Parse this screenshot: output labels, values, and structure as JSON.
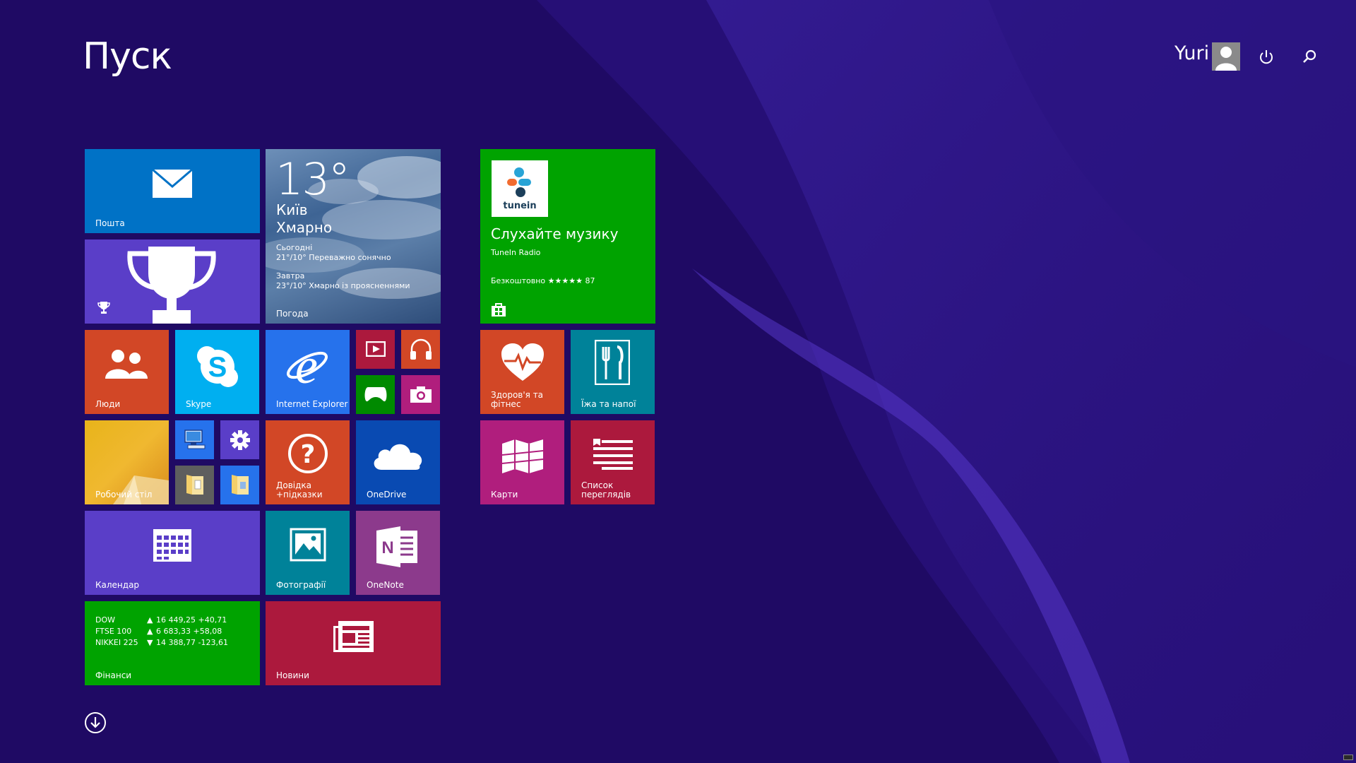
{
  "screen": {
    "title": "Пуск",
    "user": "Yuri",
    "background": "#1f0a64"
  },
  "tiles": {
    "mail": {
      "label": "Пошта",
      "color": "#0072c6",
      "icon": "mail-icon"
    },
    "games": {
      "label": "",
      "color": "#5a3ec8",
      "icon": "trophy-icon"
    },
    "weather": {
      "label": "Погода",
      "temp": "13°",
      "city": "Київ",
      "condition": "Хмарно",
      "today_label": "Сьогодні",
      "today_forecast": "21°/10° Переважно сонячно",
      "tomorrow_label": "Завтра",
      "tomorrow_forecast": "23°/10° Хмарно із проясненнями"
    },
    "people": {
      "label": "Люди",
      "color": "#d24726",
      "icon": "people-icon"
    },
    "skype": {
      "label": "Skype",
      "color": "#00aff0",
      "icon": "skype-icon"
    },
    "ie": {
      "label": "Internet Explorer",
      "color": "#2672ec",
      "icon": "internet-explorer-icon"
    },
    "video": {
      "color": "#ac193d",
      "icon": "video-icon"
    },
    "music": {
      "color": "#d24726",
      "icon": "headphones-icon"
    },
    "xbox": {
      "color": "#008a00",
      "icon": "gamepad-icon"
    },
    "camera": {
      "color": "#b01e7d",
      "icon": "camera-icon"
    },
    "desktop": {
      "label": "Робочий стіл",
      "color": "#e3a21a",
      "icon": "desktop-wallpaper"
    },
    "computer": {
      "color": "#2672ec",
      "icon": "computer-icon"
    },
    "settings": {
      "color": "#5a3ec8",
      "icon": "gear-icon"
    },
    "documents": {
      "color": "#5e5e5e",
      "icon": "documents-folder-icon"
    },
    "explorer": {
      "color": "#2672ec",
      "icon": "folder-icon"
    },
    "help": {
      "label": "Довідка +підказки",
      "color": "#d24726",
      "icon": "help-icon"
    },
    "onedrive": {
      "label": "OneDrive",
      "color": "#094ab2",
      "icon": "cloud-icon"
    },
    "calendar": {
      "label": "Календар",
      "color": "#5a3ec8",
      "icon": "calendar-icon"
    },
    "photos": {
      "label": "Фотографії",
      "color": "#008299",
      "icon": "photos-icon"
    },
    "onenote": {
      "label": "OneNote",
      "color": "#8c3a8c",
      "icon": "onenote-icon"
    },
    "finance": {
      "label": "Фінанси",
      "color": "#00a300",
      "rows": [
        {
          "name": "DOW",
          "arrow": "▲",
          "value": "16 449,25 +40,71"
        },
        {
          "name": "FTSE 100",
          "arrow": "▲",
          "value": "6 683,33 +58,08"
        },
        {
          "name": "NIKKEI 225",
          "arrow": "▼",
          "value": "14 388,77 -123,61"
        }
      ]
    },
    "news": {
      "label": "Новини",
      "color": "#ac193d",
      "icon": "news-icon"
    },
    "store": {
      "color": "#00a300",
      "app_logo_text": "tunein",
      "headline": "Слухайте музику",
      "app_name": "TuneIn Radio",
      "price_rating": "Безкоштовно ★★★★★ 87",
      "icon": "store-icon"
    },
    "health": {
      "label": "Здоров'я та фітнес",
      "color": "#d24726",
      "icon": "heart-pulse-icon"
    },
    "food": {
      "label": "Їжа та напої",
      "color": "#008299",
      "icon": "fork-knife-icon"
    },
    "maps": {
      "label": "Карти",
      "color": "#b01e7d",
      "icon": "map-icon"
    },
    "readinglist": {
      "label": "Список переглядів",
      "color": "#ac193d",
      "icon": "reading-list-icon"
    }
  }
}
